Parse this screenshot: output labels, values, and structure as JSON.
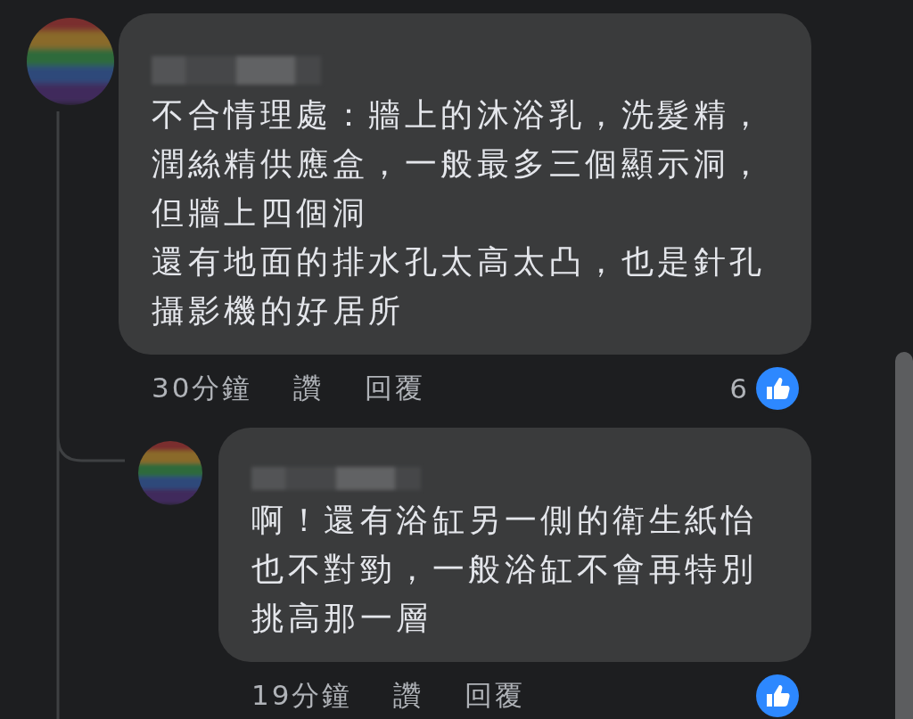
{
  "comments": [
    {
      "lines": [
        "不合情理處：牆上的沐浴乳，洗髮精，",
        "潤絲精供應盒，一般最多三個顯示洞，",
        "但牆上四個洞",
        "還有地面的排水孔太高太凸，也是針孔",
        "攝影機的好居所"
      ],
      "time": "30分鐘",
      "actions": [
        "讚",
        "回覆"
      ],
      "like_count": "6",
      "replies": [
        {
          "lines": [
            "啊！還有浴缸另一側的衛生紙怡",
            "也不對勁，一般浴缸不會再特別",
            "挑高那一層"
          ],
          "time": "19分鐘",
          "actions": [
            "讚",
            "回覆"
          ]
        }
      ]
    }
  ]
}
